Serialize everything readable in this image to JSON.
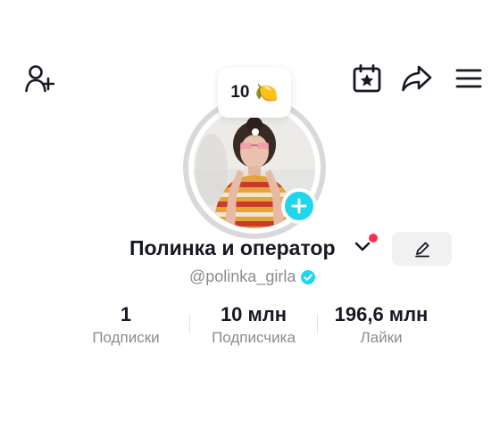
{
  "top_bar": {
    "add_friend_icon": "person-add-icon",
    "calendar_icon": "calendar-star-icon",
    "share_icon": "share-arrow-icon",
    "menu_icon": "hamburger-menu-icon"
  },
  "bubble": {
    "count": "10",
    "emoji": "🍋"
  },
  "profile": {
    "name": "Полинка и оператор",
    "handle": "@polinka_girla",
    "verified": true
  },
  "stats": [
    {
      "value": "1",
      "label": "Подписки"
    },
    {
      "value": "10 млн",
      "label": "Подписчика"
    },
    {
      "value": "196,6 млн",
      "label": "Лайки"
    }
  ],
  "colors": {
    "accent_badge": "#20d5ec",
    "notification_dot": "#fe2c55",
    "verified": "#20d5ec",
    "muted_text": "#8a8b91"
  }
}
